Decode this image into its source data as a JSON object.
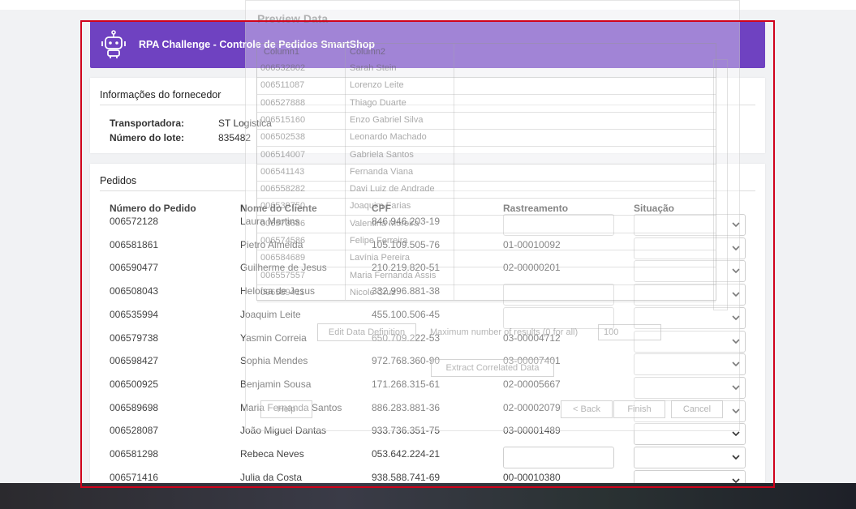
{
  "header": {
    "title": "RPA Challenge - Controle de Pedidos SmartShop",
    "color": "#6f42c1"
  },
  "supplier": {
    "title": "Informações do fornecedor",
    "carrier_label": "Transportadora:",
    "carrier_value": "ST Logistica",
    "lot_label": "Número do lote:",
    "lot_value": "835482"
  },
  "orders": {
    "title": "Pedidos",
    "columns": [
      "Número do Pedido",
      "Nome do Cliente",
      "CPF",
      "Rastreamento",
      "Situação"
    ],
    "rows": [
      {
        "order": "006572128",
        "name": "Laura Martins",
        "cpf": "846.946.203-19",
        "tracking": ""
      },
      {
        "order": "006581861",
        "name": "Pietro Almeida",
        "cpf": "105.109.505-76",
        "tracking": "01-00010092"
      },
      {
        "order": "006590477",
        "name": "Guilherme de Jesus",
        "cpf": "210.219.820-51",
        "tracking": "02-00000201"
      },
      {
        "order": "006508043",
        "name": "Heloísa de Jesus",
        "cpf": "332.996.881-38",
        "tracking": ""
      },
      {
        "order": "006535994",
        "name": "Joaquim Leite",
        "cpf": "455.100.506-45",
        "tracking": ""
      },
      {
        "order": "006579738",
        "name": "Yasmin Correia",
        "cpf": "650.709.222-53",
        "tracking": "03-00004712"
      },
      {
        "order": "006598427",
        "name": "Sophia Mendes",
        "cpf": "972.768.360-90",
        "tracking": "03-00007401"
      },
      {
        "order": "006500925",
        "name": "Benjamin Sousa",
        "cpf": "171.268.315-61",
        "tracking": "02-00005667"
      },
      {
        "order": "006589698",
        "name": "Maria Fernanda Santos",
        "cpf": "886.283.881-36",
        "tracking": "02-00002079"
      },
      {
        "order": "006528087",
        "name": "João Miguel Dantas",
        "cpf": "933.736.351-75",
        "tracking": "03-00001489"
      },
      {
        "order": "006581298",
        "name": "Rebeca Neves",
        "cpf": "053.642.224-21",
        "tracking": ""
      },
      {
        "order": "006571416",
        "name": "Julia da Costa",
        "cpf": "938.588.741-69",
        "tracking": "00-00010380"
      }
    ]
  },
  "preview_dialog": {
    "title": "Preview Data",
    "columns": [
      "Column1",
      "Column2"
    ],
    "rows": [
      [
        "006532802",
        "Sarah Stein"
      ],
      [
        "006511087",
        "Lorenzo Leite"
      ],
      [
        "006527888",
        "Thiago Duarte"
      ],
      [
        "006515160",
        "Enzo Gabriel Silva"
      ],
      [
        "006502538",
        "Leonardo Machado"
      ],
      [
        "006514007",
        "Gabriela Santos"
      ],
      [
        "006541143",
        "Fernanda Viana"
      ],
      [
        "006558282",
        "Davi Luiz de Andrade"
      ],
      [
        "006539750",
        "Joaquim Farias"
      ],
      [
        "006573686",
        "Valentina Moreira"
      ],
      [
        "006574586",
        "Felipe Ferreira"
      ],
      [
        "006584689",
        "Lavínia Pereira"
      ],
      [
        "006557557",
        "Maria Fernanda Assis"
      ],
      [
        "006589411",
        "Nicole Cruz"
      ]
    ],
    "edit_button": "Edit Data Definition",
    "max_label": "Maximum number of results (0 for all)",
    "max_value": "100",
    "extract_button": "Extract Correlated Data",
    "help_button": "Help",
    "back_button": "< Back",
    "finish_button": "Finish",
    "cancel_button": "Cancel"
  }
}
